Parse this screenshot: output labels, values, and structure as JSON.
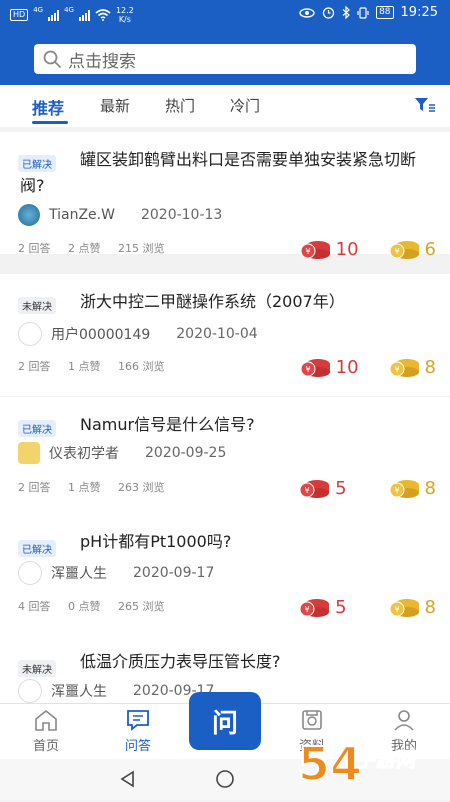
{
  "status_bar": {
    "left_badge": "HD",
    "network1": "4G",
    "network2": "4G",
    "speed_value": "12.2",
    "speed_unit": "K/s",
    "battery": "88",
    "time": "19:25"
  },
  "search": {
    "placeholder": "点击搜索"
  },
  "tabs": [
    {
      "label": "推荐",
      "active": true
    },
    {
      "label": "最新",
      "active": false
    },
    {
      "label": "热门",
      "active": false
    },
    {
      "label": "冷门",
      "active": false
    }
  ],
  "questions": [
    {
      "status": "已解决",
      "title": "罐区装卸鹤臂出料口是否需要单独安装紧急切断阀?",
      "author": "TianZe.W",
      "date": "2020-10-13",
      "answers": "2 回答",
      "likes": "2 点赞",
      "views": "215 浏览",
      "red_reward": "10",
      "gold_reward": "6"
    },
    {
      "status": "未解决",
      "title": "浙大中控二甲醚操作系统（2007年）",
      "author": "用户00000149",
      "date": "2020-10-04",
      "answers": "2 回答",
      "likes": "1 点赞",
      "views": "166 浏览",
      "red_reward": "10",
      "gold_reward": "8"
    },
    {
      "status": "已解决",
      "title": "Namur信号是什么信号?",
      "author": "仪表初学者",
      "date": "2020-09-25",
      "answers": "2 回答",
      "likes": "1 点赞",
      "views": "263 浏览",
      "red_reward": "5",
      "gold_reward": "8"
    },
    {
      "status": "已解决",
      "title": "pH计都有Pt1000吗?",
      "author": "浑噩人生",
      "date": "2020-09-17",
      "answers": "4 回答",
      "likes": "0 点赞",
      "views": "265 浏览",
      "red_reward": "5",
      "gold_reward": "8"
    },
    {
      "status": "未解决",
      "title": "低温介质压力表导压管长度?",
      "author": "浑噩人生",
      "date": "2020-09-17"
    }
  ],
  "bottom_nav": {
    "home": "首页",
    "qa": "问答",
    "ask": "问",
    "resources": "资料",
    "mine": "我的"
  },
  "watermark": "54手游网",
  "colors": {
    "primary": "#1b5fc4",
    "red_coin": "#d63c3c",
    "gold_coin": "#d9a520"
  }
}
